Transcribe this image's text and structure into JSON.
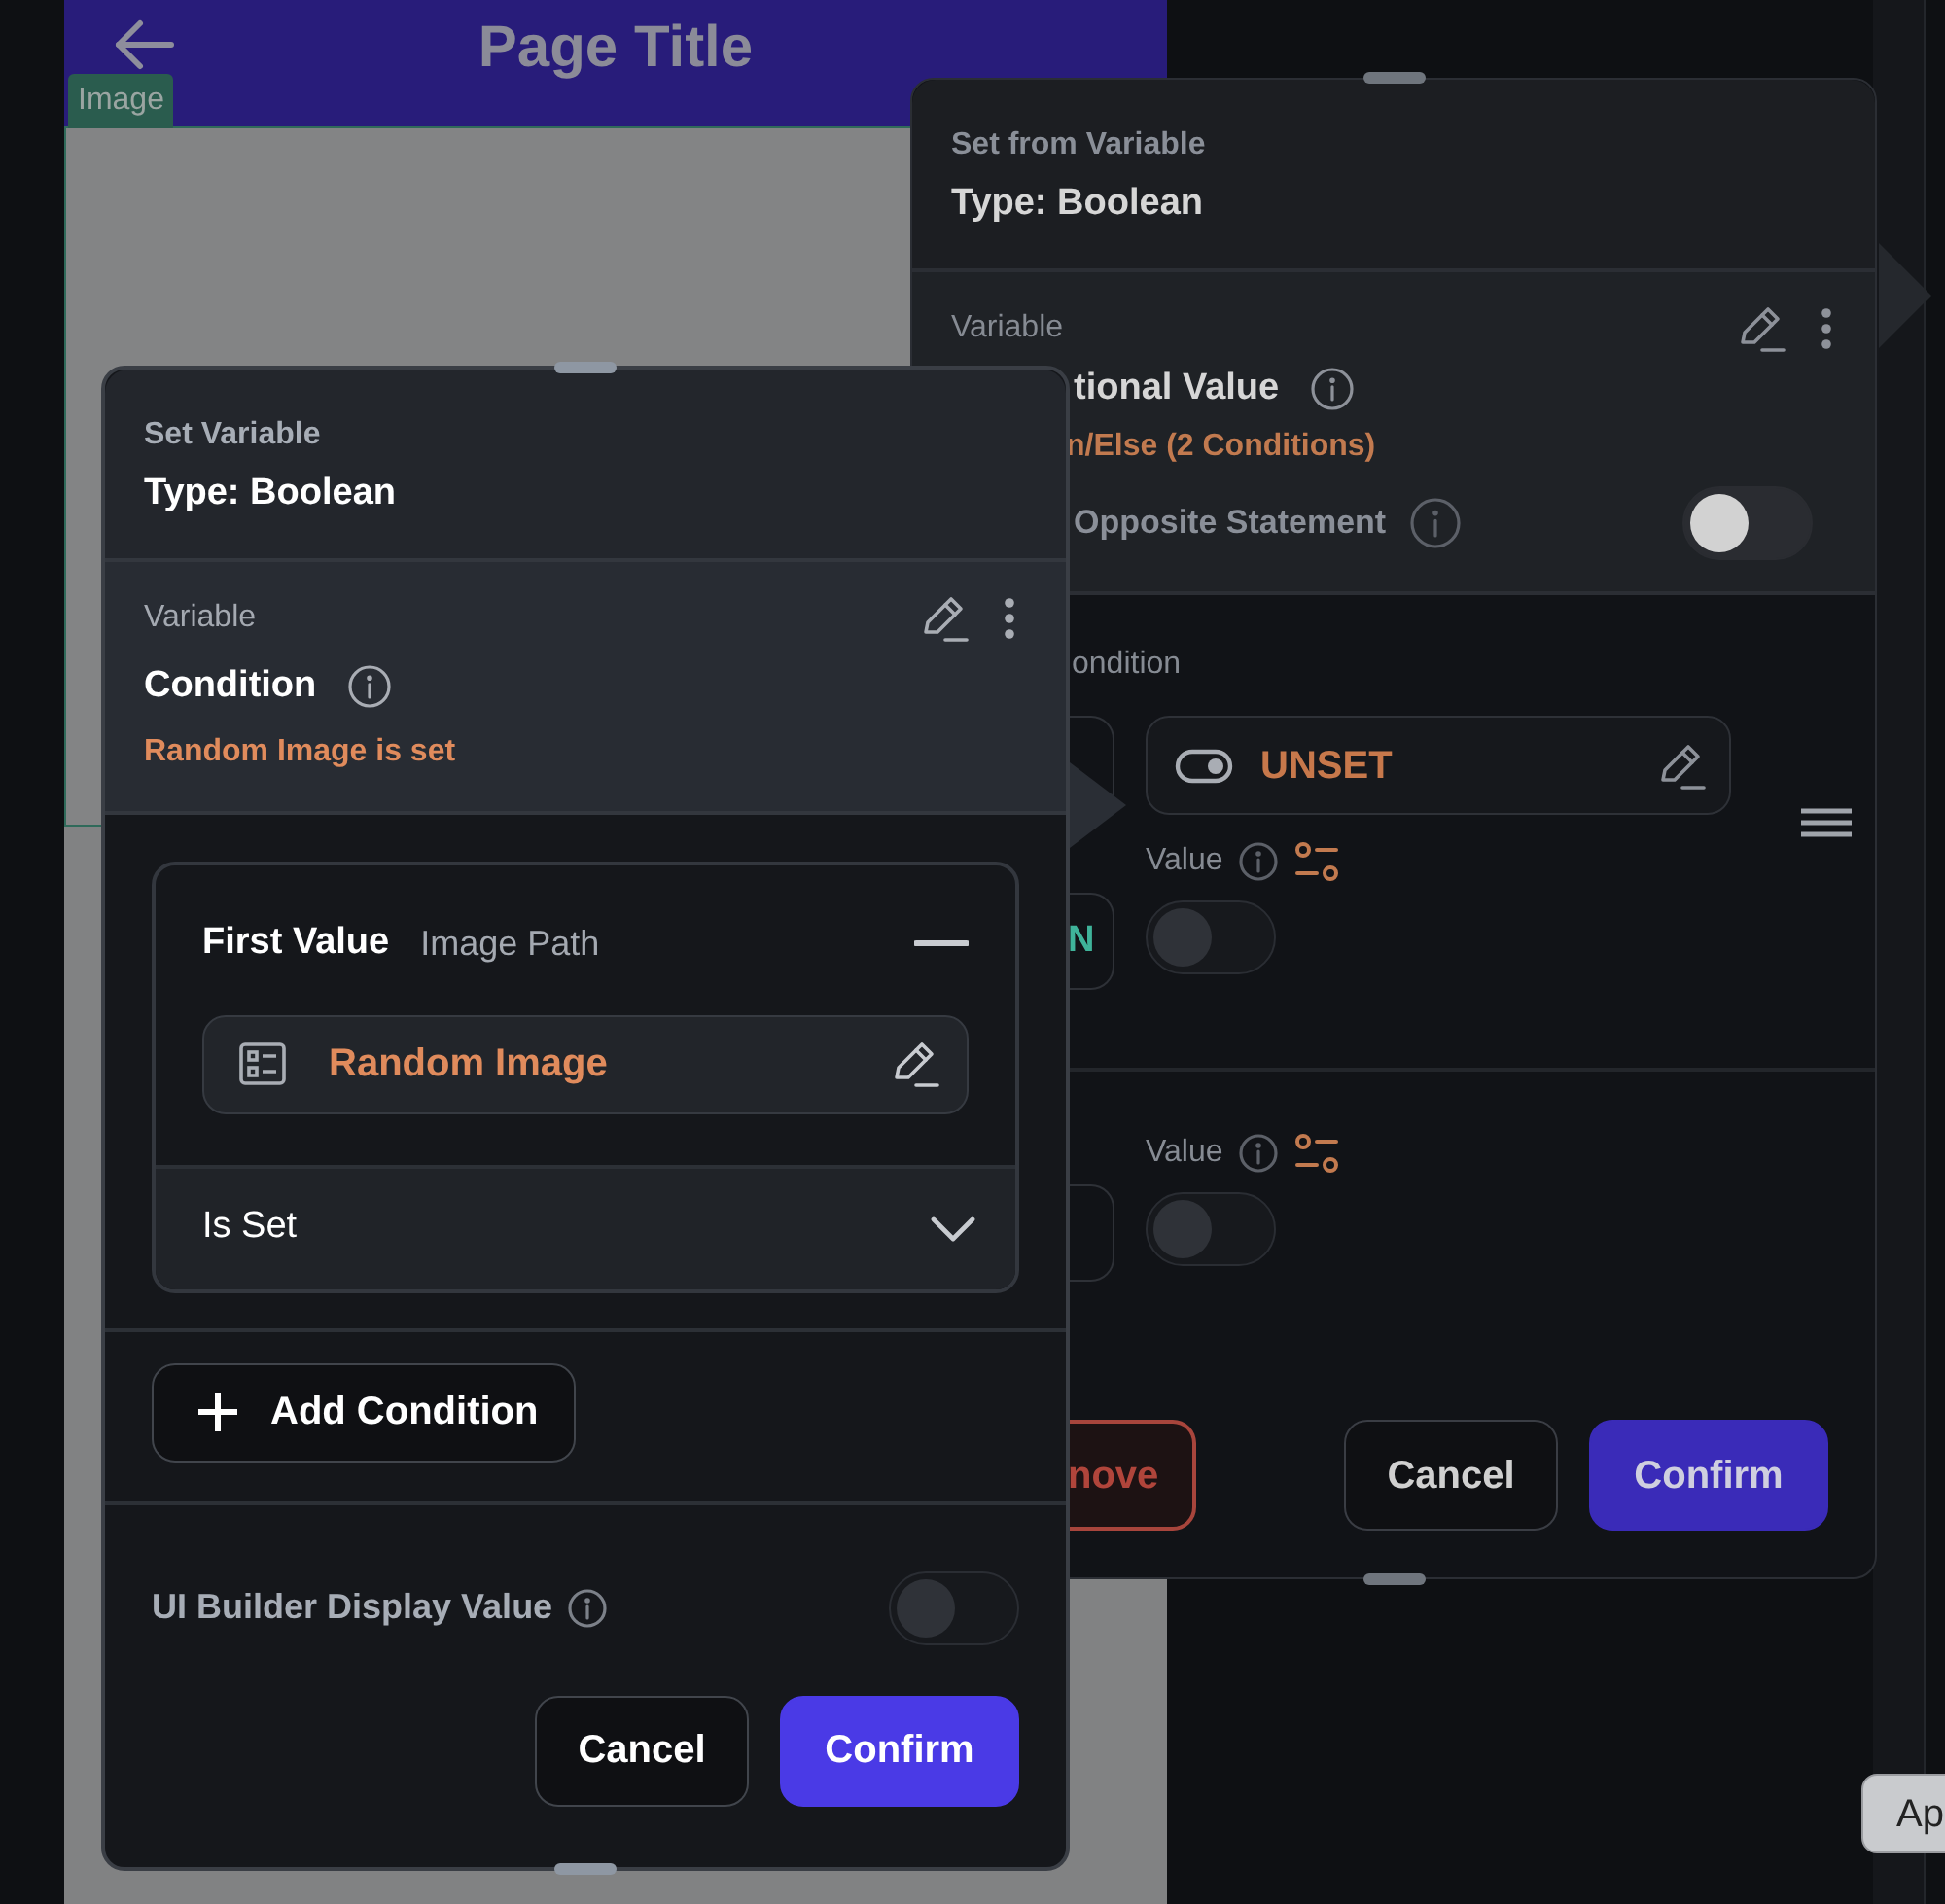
{
  "app_preview": {
    "title": "Page Title",
    "element_tag": "Image"
  },
  "set_from_variable_panel": {
    "title": "Set from Variable",
    "type": "Type: Boolean",
    "variable_label": "Variable",
    "variable_name": "tional Value",
    "variable_summary": "n/Else (2 Conditions)",
    "opposite_statement": {
      "label": "Opposite Statement",
      "on": false
    },
    "conditions_label": "ondition",
    "conditions": [
      {
        "value_field": "UNSET",
        "value_label": "Value",
        "side_text": "N",
        "on": false
      },
      {
        "value_label": "Value",
        "on": false
      }
    ],
    "buttons": [
      {
        "label": "nove",
        "kind": "danger"
      },
      {
        "label": "Cancel",
        "kind": "secondary"
      },
      {
        "label": "Confirm",
        "kind": "primary"
      }
    ]
  },
  "set_variable_panel": {
    "title": "Set Variable",
    "type": "Type: Boolean",
    "variable_label": "Variable",
    "variable_name": "Condition",
    "variable_summary": "Random Image is set",
    "conditions": [
      {
        "title": "First Value",
        "subtitle": "Image Path",
        "value_field": "Random Image",
        "operator": "Is Set"
      }
    ],
    "add_button": "Add Condition",
    "display_value": {
      "label": "UI Builder Display Value",
      "on": false
    },
    "buttons": [
      {
        "label": "Cancel",
        "kind": "secondary"
      },
      {
        "label": "Confirm",
        "kind": "primary"
      }
    ]
  },
  "corner_button": "Ap"
}
